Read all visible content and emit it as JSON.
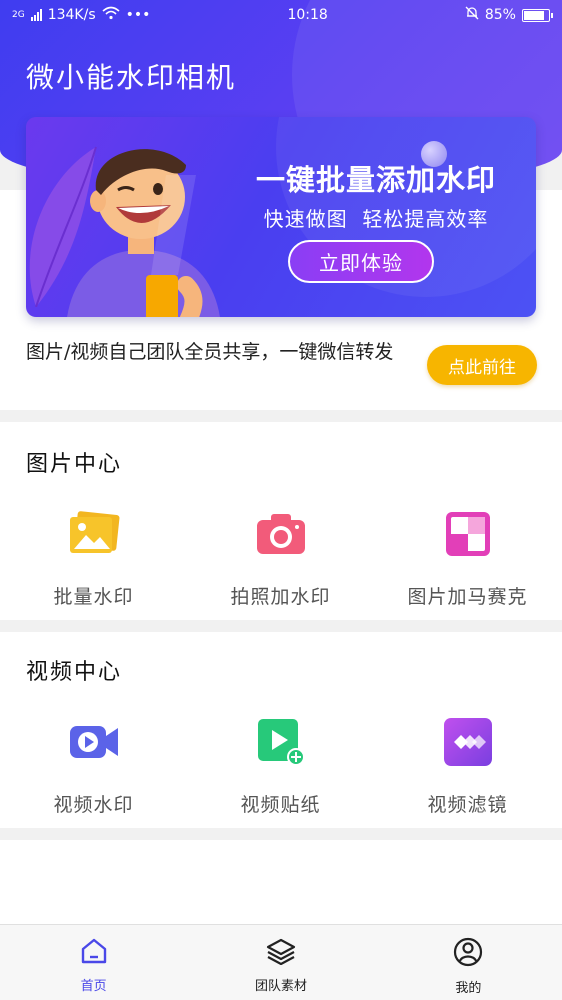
{
  "status_bar": {
    "network_type": "2G",
    "speed": "134K/s",
    "time": "10:18",
    "battery": "85%",
    "battery_level": 0.85
  },
  "app": {
    "title": "微小能水印相机"
  },
  "banner": {
    "headline": "一键批量添加水印",
    "subline": "快速做图  轻松提高效率",
    "cta_label": "立即体验"
  },
  "share": {
    "text": "图片/视频自己团队全员共享，一键微信转发",
    "button_label": "点此前往"
  },
  "picture_center": {
    "title": "图片中心",
    "items": [
      {
        "label": "批量水印",
        "icon": "batch-watermark-icon"
      },
      {
        "label": "拍照加水印",
        "icon": "camera-icon"
      },
      {
        "label": "图片加马赛克",
        "icon": "mosaic-icon"
      }
    ]
  },
  "video_center": {
    "title": "视频中心",
    "items": [
      {
        "label": "视频水印",
        "icon": "video-camera-icon"
      },
      {
        "label": "视频贴纸",
        "icon": "video-sticker-icon"
      },
      {
        "label": "视频滤镜",
        "icon": "video-filter-icon"
      }
    ]
  },
  "bottom_nav": {
    "items": [
      {
        "label": "首页",
        "icon": "home-icon",
        "active": true
      },
      {
        "label": "团队素材",
        "icon": "layers-icon",
        "active": false
      },
      {
        "label": "我的",
        "icon": "user-icon",
        "active": false
      }
    ]
  },
  "colors": {
    "primary": "#4a48e8",
    "accent_yellow": "#f7b500",
    "pink": "#f25b7a",
    "purple": "#a445e8"
  }
}
